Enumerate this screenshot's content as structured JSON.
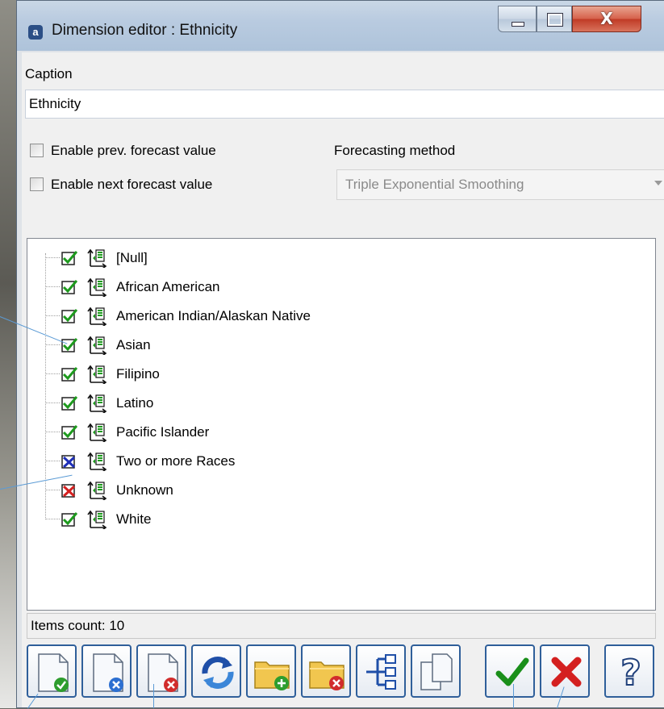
{
  "window": {
    "title": "Dimension editor : Ethnicity",
    "app_badge": "a",
    "controls": [
      "minimize",
      "maximize",
      "close"
    ]
  },
  "caption": {
    "label": "Caption",
    "value": "Ethnicity"
  },
  "options": {
    "enable_prev": {
      "label": "Enable prev. forecast value",
      "checked": false
    },
    "enable_next": {
      "label": "Enable next forecast value",
      "checked": false
    }
  },
  "forecasting": {
    "label": "Forecasting method",
    "selected": "Triple Exponential Smoothing",
    "disabled": true
  },
  "tree": {
    "items": [
      {
        "label": "[Null]",
        "state": "checked"
      },
      {
        "label": "African American",
        "state": "checked"
      },
      {
        "label": "American Indian/Alaskan Native",
        "state": "checked"
      },
      {
        "label": "Asian",
        "state": "checked"
      },
      {
        "label": "Filipino",
        "state": "checked"
      },
      {
        "label": "Latino",
        "state": "checked"
      },
      {
        "label": "Pacific Islander",
        "state": "checked"
      },
      {
        "label": "Two or more Races",
        "state": "excluded-blue"
      },
      {
        "label": "Unknown",
        "state": "excluded-red"
      },
      {
        "label": "White",
        "state": "checked"
      }
    ]
  },
  "status": {
    "items_count": "Items count: 10"
  },
  "toolbar": {
    "buttons": [
      {
        "name": "enable-item",
        "icon": "page-check-icon"
      },
      {
        "name": "disable-item",
        "icon": "page-blue-x-icon"
      },
      {
        "name": "delete-item",
        "icon": "page-red-x-icon"
      },
      {
        "name": "refresh",
        "icon": "refresh-icon"
      },
      {
        "name": "add-folder",
        "icon": "folder-add-icon"
      },
      {
        "name": "remove-folder",
        "icon": "folder-remove-icon"
      },
      {
        "name": "hierarchy",
        "icon": "hierarchy-icon"
      },
      {
        "name": "copy",
        "icon": "copy-pages-icon"
      },
      {
        "name": "ok",
        "icon": "green-check-icon"
      },
      {
        "name": "cancel",
        "icon": "red-x-icon"
      },
      {
        "name": "help",
        "icon": "help-icon"
      }
    ]
  },
  "colors": {
    "check_green": "#1d9a1d",
    "exclude_blue": "#1f2fb8",
    "exclude_red": "#d42020",
    "button_border": "#2f5f9a"
  }
}
